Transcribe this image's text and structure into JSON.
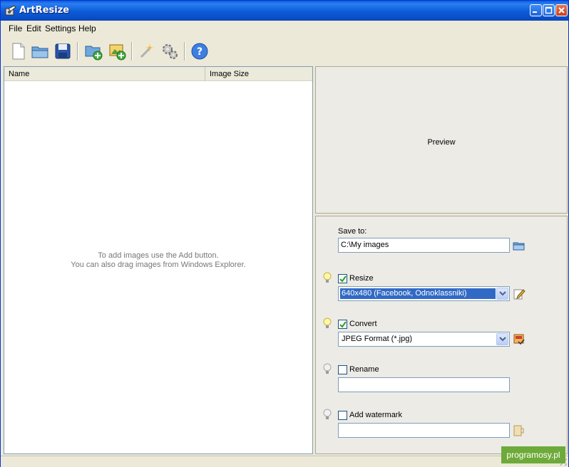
{
  "window": {
    "title": "ArtResize"
  },
  "menu": {
    "items": [
      "File",
      "Edit",
      "Settings",
      "Help"
    ]
  },
  "toolbar": {
    "icons": [
      "new-file-icon",
      "open-folder-icon",
      "save-icon",
      "add-folder-icon",
      "add-image-icon",
      "magic-wand-icon",
      "settings-gears-icon",
      "help-icon"
    ]
  },
  "list": {
    "columns": [
      "Name",
      "Image Size"
    ],
    "hint_line1": "To add images use the Add button.",
    "hint_line2": "You can also drag images from Windows Explorer."
  },
  "preview": {
    "label": "Preview"
  },
  "options": {
    "save_to": {
      "label": "Save to:",
      "value": "C:\\My images"
    },
    "resize": {
      "label": "Resize",
      "checked": true,
      "value": "640x480 (Facebook, Odnoklassniki)"
    },
    "convert": {
      "label": "Convert",
      "checked": true,
      "value": "JPEG Format (*.jpg)"
    },
    "rename": {
      "label": "Rename",
      "checked": false,
      "value": ""
    },
    "watermark": {
      "label": "Add watermark",
      "checked": false,
      "value": ""
    }
  },
  "overlay": {
    "text": "programosy.pl"
  },
  "colors": {
    "titlebar": "#0b5bd6",
    "selection": "#316ac5",
    "field_border": "#7f9db9"
  }
}
